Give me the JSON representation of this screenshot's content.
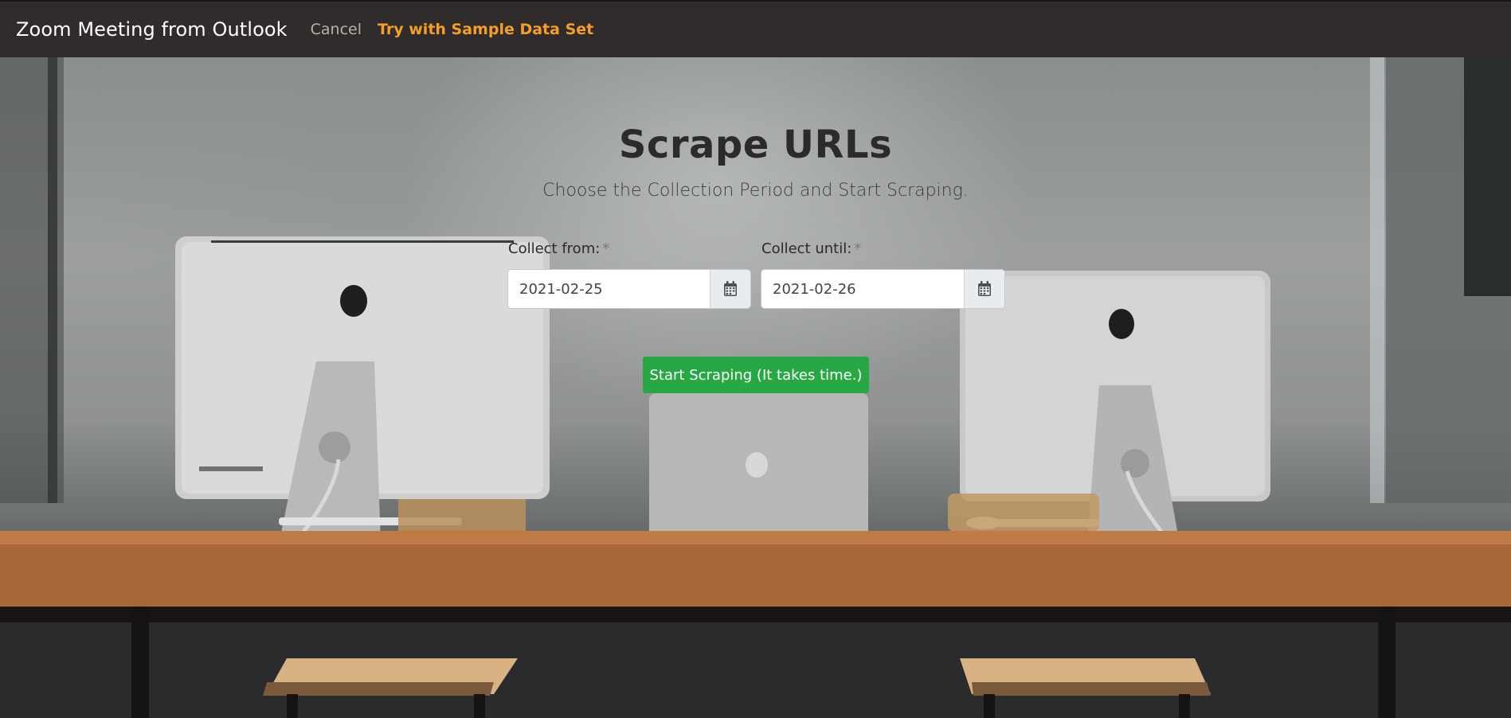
{
  "navbar": {
    "brand": "Zoom Meeting from Outlook",
    "cancel_label": "Cancel",
    "sample_label": "Try with Sample Data Set",
    "accent_color": "#f59f26"
  },
  "main": {
    "title": "Scrape URLs",
    "subtitle": "Choose the Collection Period and Start Scraping.",
    "from": {
      "label": "Collect from:",
      "required_mark": "*",
      "value": "2021-02-25",
      "icon": "calendar-icon"
    },
    "until": {
      "label": "Collect until:",
      "required_mark": "*",
      "value": "2021-02-26",
      "icon": "calendar-icon"
    },
    "start_button": {
      "label": "Start Scraping (It takes time.)",
      "color": "#28a745"
    }
  }
}
